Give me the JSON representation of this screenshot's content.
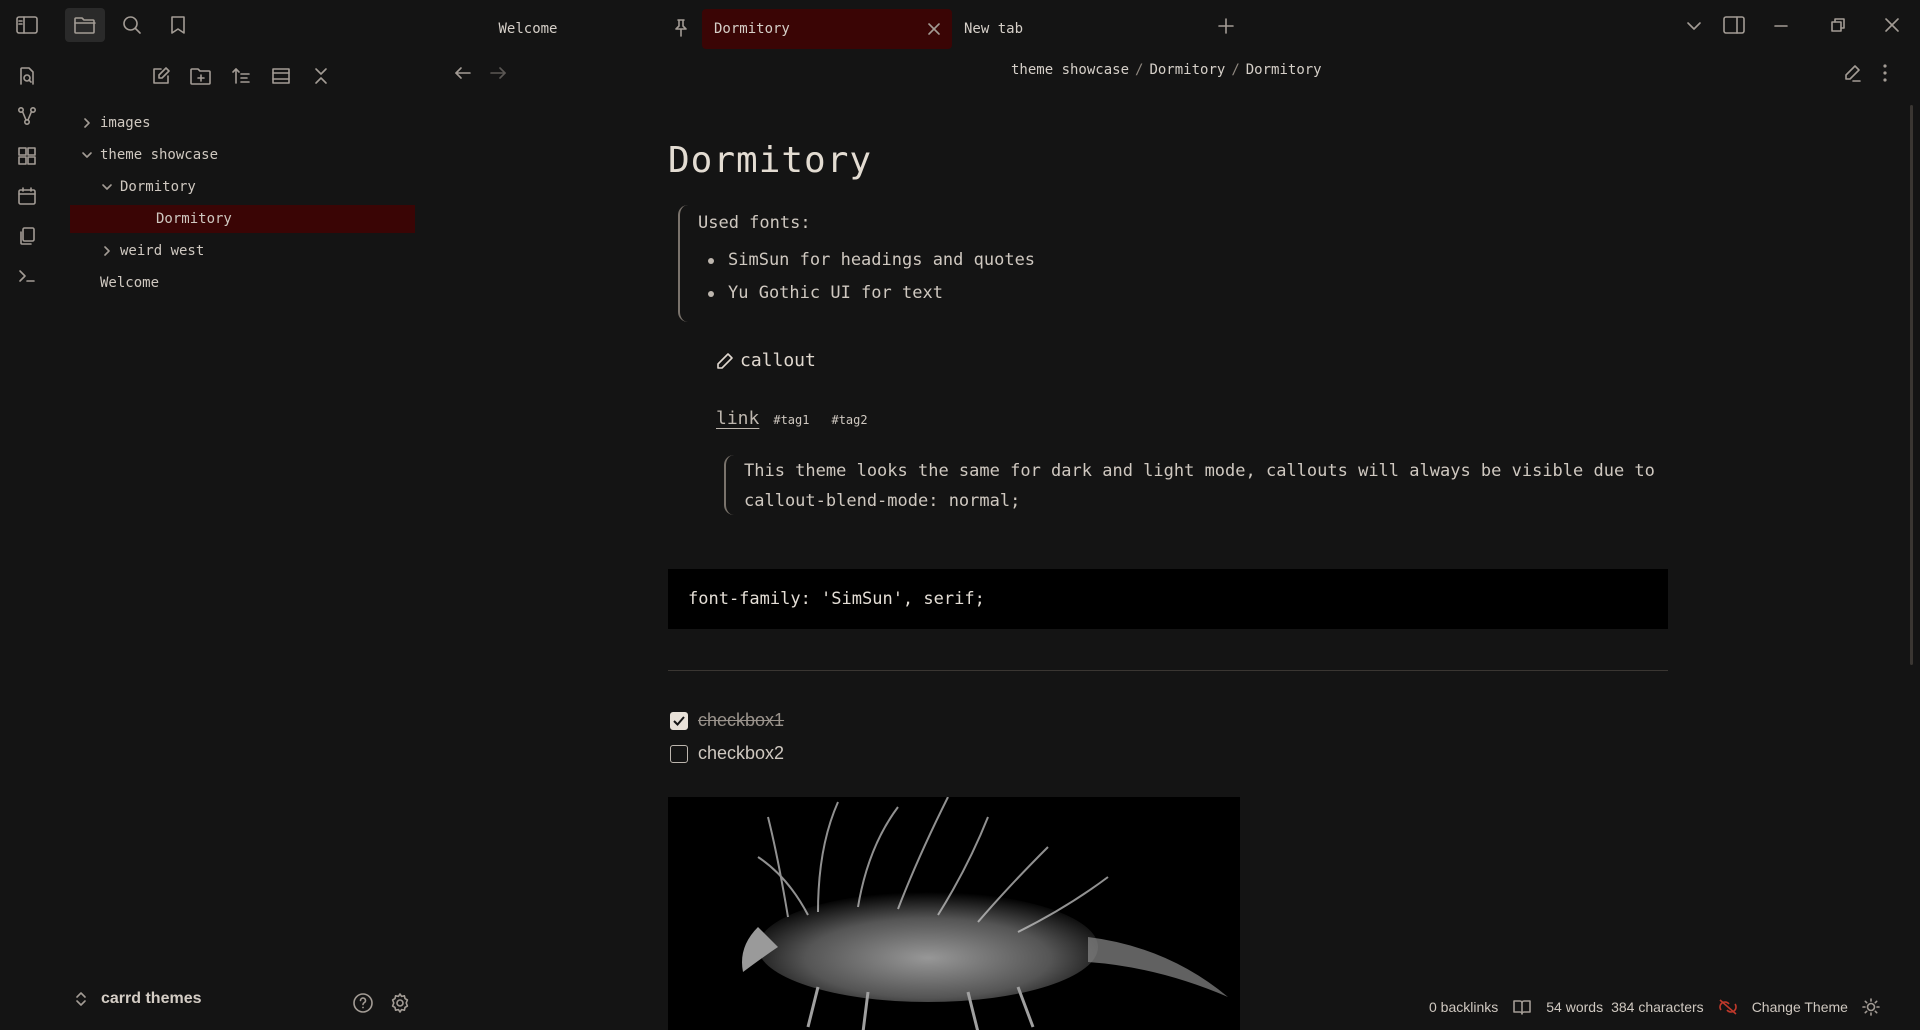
{
  "tabs": [
    {
      "label": "Welcome"
    },
    {
      "label": "Dormitory"
    },
    {
      "label": "New tab"
    }
  ],
  "breadcrumb": [
    "theme showcase",
    "Dormitory",
    "Dormitory"
  ],
  "breadcrumb_sep": "/",
  "tree": {
    "images": "images",
    "theme_showcase": "theme showcase",
    "dormitory_folder": "Dormitory",
    "dormitory_note": "Dormitory",
    "weird_west": "weird west",
    "welcome": "Welcome"
  },
  "vault_name": "carrd themes",
  "doc": {
    "title": "Dormitory",
    "quote1_heading": "Used fonts:",
    "quote1_items": [
      "SimSun for headings and quotes",
      "Yu Gothic UI for text"
    ],
    "callout_title": "callout",
    "link_text": "link",
    "tags": [
      "#tag1",
      "#tag2"
    ],
    "quote2_line1": "This theme looks the same for dark and light mode, callouts will always be visible due to",
    "quote2_line2": "callout-blend-mode: normal;",
    "code": "font-family: 'SimSun', serif;",
    "checkbox1": {
      "label": "checkbox1",
      "checked": true
    },
    "checkbox2": {
      "label": "checkbox2",
      "checked": false
    }
  },
  "status": {
    "backlinks": "0 backlinks",
    "words": "54 words",
    "characters": "384 characters",
    "change_theme": "Change Theme"
  },
  "colors": {
    "background": "#141414",
    "accent": "#3a0505",
    "sync_error": "#c0392b"
  }
}
